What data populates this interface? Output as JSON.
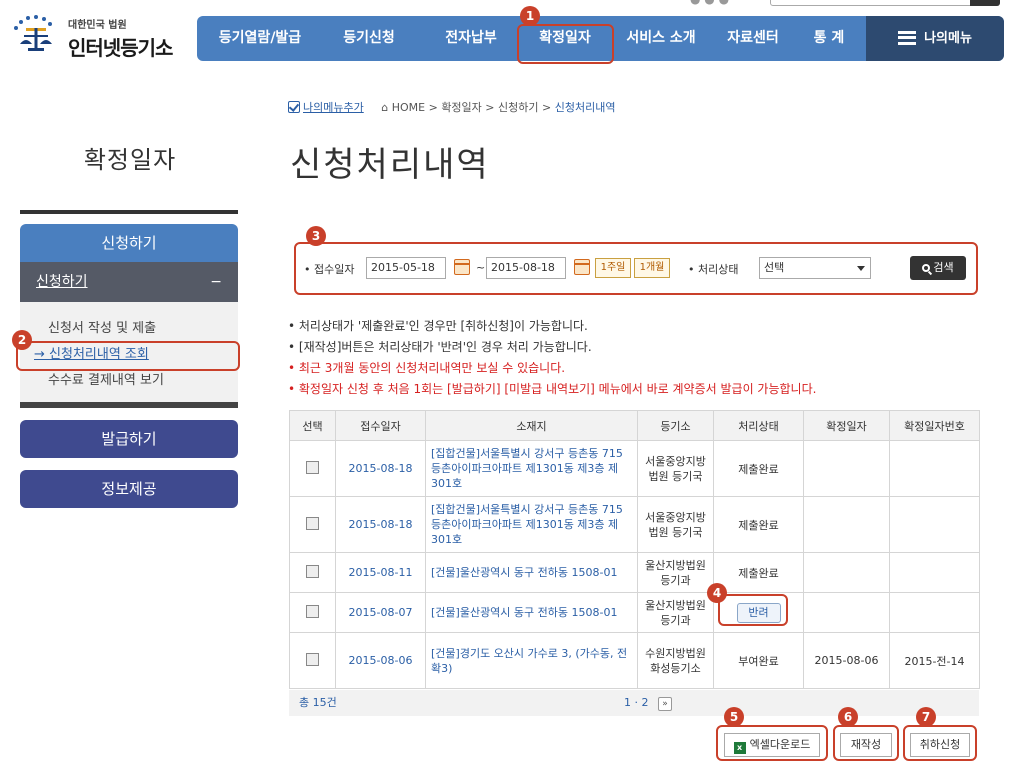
{
  "logo": {
    "small": "대한민국 법원",
    "big": "인터넷등기소"
  },
  "nav": {
    "items": [
      "등기열람/발급",
      "등기신청",
      "전자납부",
      "확정일자",
      "서비스 소개",
      "자료센터",
      "통 계"
    ],
    "my_menu": "나의메뉴"
  },
  "breadcrumb": {
    "add_my_menu": "나의메뉴추가",
    "home": "HOME",
    "path1": "확정일자",
    "path2": "신청하기",
    "current": "신청처리내역"
  },
  "side": {
    "title": "확정일자",
    "apply": "신청하기",
    "apply_sub_header": "신청하기",
    "sub_items": [
      "신청서 작성 및 제출",
      "신청처리내역 조회",
      "수수료 결제내역 보기"
    ],
    "issue": "발급하기",
    "info": "정보제공"
  },
  "page_title": "신청처리내역",
  "search": {
    "date_label": "• 접수일자",
    "from": "2015-05-18",
    "to": "2015-08-18",
    "week_btn": "1주일",
    "month_btn": "1개월",
    "status_label": "• 처리상태",
    "status_value": "선택",
    "search_btn": "검색"
  },
  "notes": [
    "• 처리상태가 '제출완료'인 경우만 [취하신청]이 가능합니다.",
    "• [재작성]버튼은 처리상태가 '반려'인 경우 처리 가능합니다.",
    "• 최근 3개월 동안의 신청처리내역만 보실 수 있습니다.",
    "• 확정일자 신청 후 처음 1회는 [발급하기] [미발급 내역보기] 메뉴에서 바로 계약증서 발급이 가능합니다."
  ],
  "table": {
    "headers": [
      "선택",
      "접수일자",
      "소재지",
      "등기소",
      "처리상태",
      "확정일자",
      "확정일자번호"
    ],
    "rows": [
      {
        "date": "2015-08-18",
        "addr": "[집합건물]서울특별시 강서구 등촌동 715 등촌아이파크아파트 제1301동 제3층 제301호",
        "court": "서울중앙지방법원 등기국",
        "status": "제출완료",
        "fix_date": "",
        "fix_no": ""
      },
      {
        "date": "2015-08-18",
        "addr": "[집합건물]서울특별시 강서구 등촌동 715 등촌아이파크아파트 제1301동 제3층 제301호",
        "court": "서울중앙지방법원 등기국",
        "status": "제출완료",
        "fix_date": "",
        "fix_no": ""
      },
      {
        "date": "2015-08-11",
        "addr": "[건물]울산광역시 동구 전하동 1508-01",
        "court": "울산지방법원 등기과",
        "status": "제출완료",
        "fix_date": "",
        "fix_no": ""
      },
      {
        "date": "2015-08-07",
        "addr": "[건물]울산광역시 동구 전하동 1508-01",
        "court": "울산지방법원 등기과",
        "status": "반려",
        "fix_date": "",
        "fix_no": ""
      },
      {
        "date": "2015-08-06",
        "addr": "[건물]경기도 오산시 가수로 3, (가수동, 전확3)",
        "court": "수원지방법원 화성등기소",
        "status": "부여완료",
        "fix_date": "2015-08-06",
        "fix_no": "2015-전-14"
      }
    ]
  },
  "footer": {
    "total": "총 15건",
    "page1": "1",
    "sep": "·",
    "page2": "2",
    "next": "»"
  },
  "actions": {
    "excel": "엑셀다운로드",
    "rewrite": "재작성",
    "cancel": "취하신청"
  },
  "callouts": [
    "1",
    "2",
    "3",
    "4",
    "5",
    "6",
    "7"
  ],
  "colors": {
    "nav_blue": "#4a7fbf",
    "nav_dark": "#2d4a70",
    "callout_red": "#c9402a",
    "link_blue": "#2b5fa6",
    "side_purple": "#3f4a8f"
  }
}
